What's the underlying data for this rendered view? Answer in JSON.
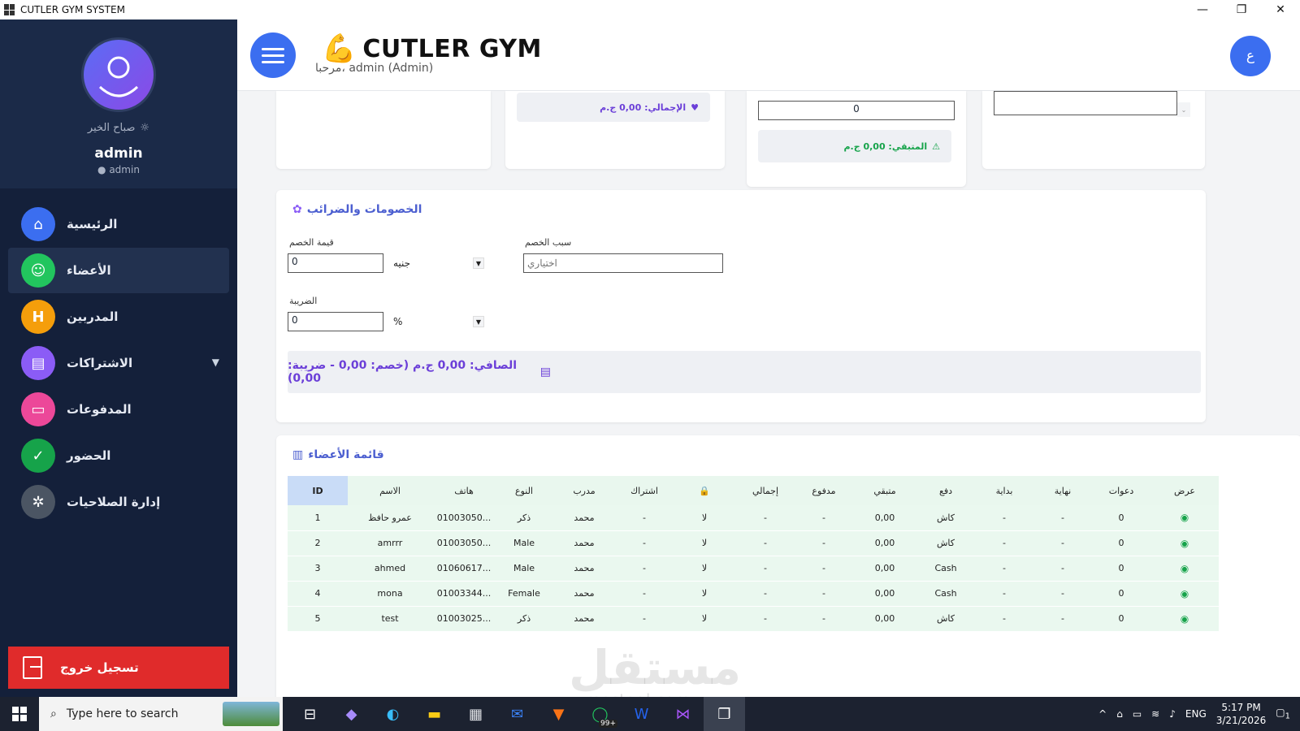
{
  "window": {
    "title": "CUTLER GYM SYSTEM",
    "minimize": "—",
    "restore": "❐",
    "close": "✕"
  },
  "sidebar": {
    "greeting": "صباح الخير",
    "username": "admin",
    "role": "● admin",
    "items": [
      {
        "label": "الرئيسية",
        "icon": "home-icon",
        "color": "#3b6ef0",
        "glyph": "⌂"
      },
      {
        "label": "الأعضاء",
        "icon": "members-icon",
        "color": "#22c55e",
        "glyph": "☺"
      },
      {
        "label": "المدربين",
        "icon": "dumbbell-icon",
        "color": "#f59e0b",
        "glyph": "H"
      },
      {
        "label": "الاشتراكات",
        "icon": "subscriptions-icon",
        "color": "#8b5cf6",
        "glyph": "▤"
      },
      {
        "label": "المدفوعات",
        "icon": "payments-icon",
        "color": "#ec4899",
        "glyph": "▭"
      },
      {
        "label": "الحضور",
        "icon": "check-icon",
        "color": "#16a34a",
        "glyph": "✓"
      },
      {
        "label": "إدارة الصلاحيات",
        "icon": "gear-icon",
        "color": "#4b5563",
        "glyph": "✲"
      }
    ],
    "logout": "تسجيل خروج"
  },
  "header": {
    "brand": "CUTLER GYM",
    "welcome": "مرحبا، admin (Admin)",
    "lang": "ع"
  },
  "summary": {
    "total": "الإجمالي: 0,00 ج.م",
    "paid_value": "0",
    "remaining": "المتبقي: 0,00 ج.م"
  },
  "discounts": {
    "title": "الخصومات والضرائب",
    "discount_value_label": "قيمة الخصم",
    "discount_value": "0",
    "currency_unit": "جنيه",
    "discount_reason_label": "سبب الخصم",
    "discount_reason_placeholder": "اختياري",
    "tax_label": "الضريبة",
    "tax_value": "0",
    "tax_unit": "%",
    "net": "الصافي: 0,00 ج.م (خصم: 0,00 - ضريبة: 0,00)"
  },
  "members": {
    "title": "قائمة الأعضاء",
    "columns": [
      "ID",
      "الاسم",
      "هاتف",
      "النوع",
      "مدرب",
      "اشتراك",
      "",
      "إجمالي",
      "مدفوع",
      "متبقي",
      "دفع",
      "بداية",
      "نهاية",
      "دعوات",
      "عرض"
    ],
    "rows": [
      [
        "1",
        "عمرو حافظ",
        "01003050...",
        "ذكر",
        "محمد",
        "-",
        "لا",
        "-",
        "-",
        "0,00",
        "كاش",
        "-",
        "-",
        "0"
      ],
      [
        "2",
        "amrrr",
        "01003050...",
        "Male",
        "محمد",
        "-",
        "لا",
        "-",
        "-",
        "0,00",
        "كاش",
        "-",
        "-",
        "0"
      ],
      [
        "3",
        "ahmed",
        "01060617...",
        "Male",
        "محمد",
        "-",
        "لا",
        "-",
        "-",
        "0,00",
        "Cash",
        "-",
        "-",
        "0"
      ],
      [
        "4",
        "mona",
        "01003344...",
        "Female",
        "محمد",
        "-",
        "لا",
        "-",
        "-",
        "0,00",
        "Cash",
        "-",
        "-",
        "0"
      ],
      [
        "5",
        "test",
        "01003025...",
        "ذكر",
        "محمد",
        "-",
        "لا",
        "-",
        "-",
        "0,00",
        "كاش",
        "-",
        "-",
        "0"
      ]
    ]
  },
  "watermark": {
    "text": "مستقل",
    "domain": "mostaql.com"
  },
  "taskbar": {
    "search_placeholder": "Type here to search",
    "badge": "99+",
    "lang": "ENG",
    "time": "5:17 PM",
    "date": "3/21/2026",
    "notifications": "1"
  }
}
